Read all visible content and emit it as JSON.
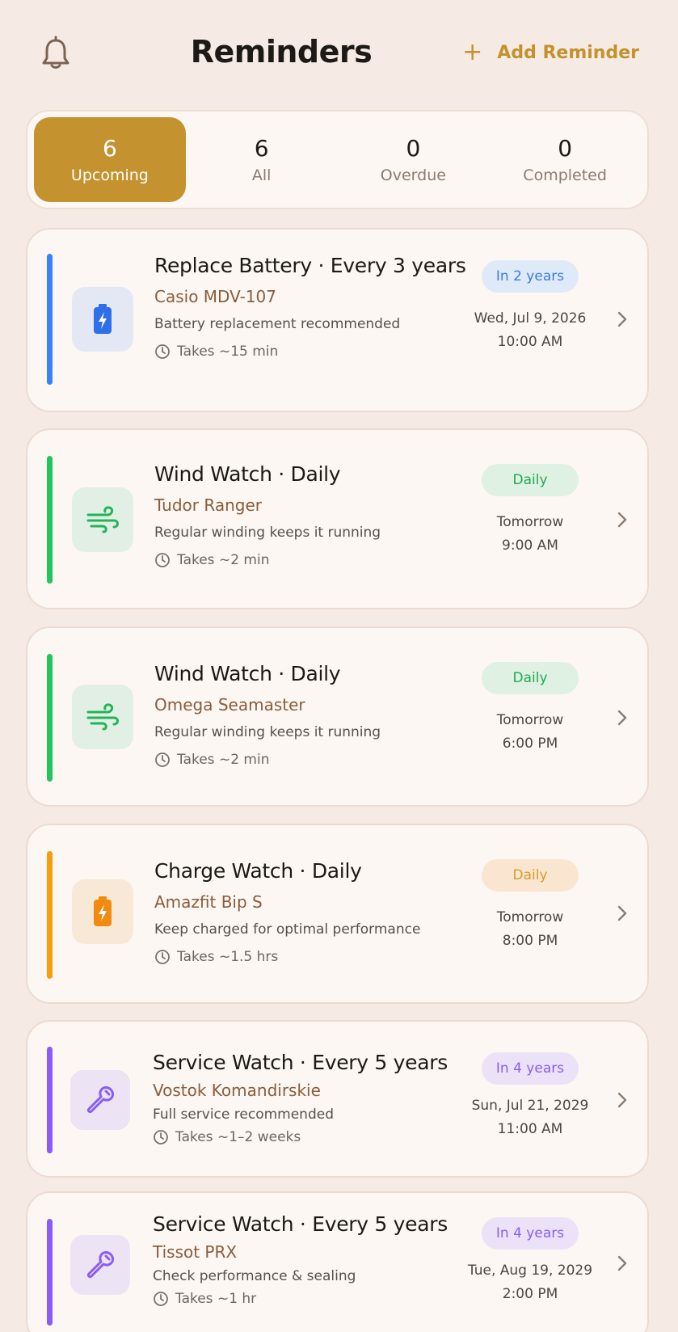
{
  "header": {
    "title": "Reminders",
    "add_label": "Add Reminder",
    "add_icon": "plus-icon",
    "bell_icon": "bell-icon",
    "accent_color": "#c4922f"
  },
  "tabs": [
    {
      "count": "6",
      "label": "Upcoming",
      "active": true
    },
    {
      "count": "6",
      "label": "All",
      "active": false
    },
    {
      "count": "0",
      "label": "Overdue",
      "active": false
    },
    {
      "count": "0",
      "label": "Completed",
      "active": false
    }
  ],
  "reminders": [
    {
      "title": "Replace Battery · Every 3 years",
      "watch": "Casio MDV-107",
      "description": "Battery replacement recommended",
      "duration": "Takes ~15 min",
      "badge": "In 2 years",
      "date": "Wed, Jul 9, 2026",
      "time": "10:00 AM",
      "icon": "battery-icon",
      "accent": "#3b82f6"
    },
    {
      "title": "Wind Watch · Daily",
      "watch": "Tudor Ranger",
      "description": "Regular winding keeps it running",
      "duration": "Takes ~2 min",
      "badge": "Daily",
      "date": "Tomorrow",
      "time": "9:00 AM",
      "icon": "wind-icon",
      "accent": "#22c55e"
    },
    {
      "title": "Wind Watch · Daily",
      "watch": "Omega Seamaster",
      "description": "Regular winding keeps it running",
      "duration": "Takes ~2 min",
      "badge": "Daily",
      "date": "Tomorrow",
      "time": "6:00 PM",
      "icon": "wind-icon",
      "accent": "#22c55e"
    },
    {
      "title": "Charge Watch · Daily",
      "watch": "Amazfit Bip S",
      "description": "Keep charged for optimal performance",
      "duration": "Takes ~1.5 hrs",
      "badge": "Daily",
      "date": "Tomorrow",
      "time": "8:00 PM",
      "icon": "battery-icon",
      "accent": "#f59e0b"
    },
    {
      "title": "Service Watch · Every 5 years",
      "watch": "Vostok Komandirskie",
      "description": "Full service recommended",
      "duration": "Takes ~1–2 weeks",
      "badge": "In 4 years",
      "date": "Sun, Jul 21, 2029",
      "time": "11:00 AM",
      "icon": "wrench-icon",
      "accent": "#8b5cf6"
    },
    {
      "title": "Service Watch · Every 5 years",
      "watch": "Tissot PRX",
      "description": "Check performance & sealing",
      "duration": "Takes ~1 hr",
      "badge": "In 4 years",
      "date": "Tue, Aug 19, 2029",
      "time": "2:00 PM",
      "icon": "wrench-icon",
      "accent": "#8b5cf6"
    }
  ]
}
